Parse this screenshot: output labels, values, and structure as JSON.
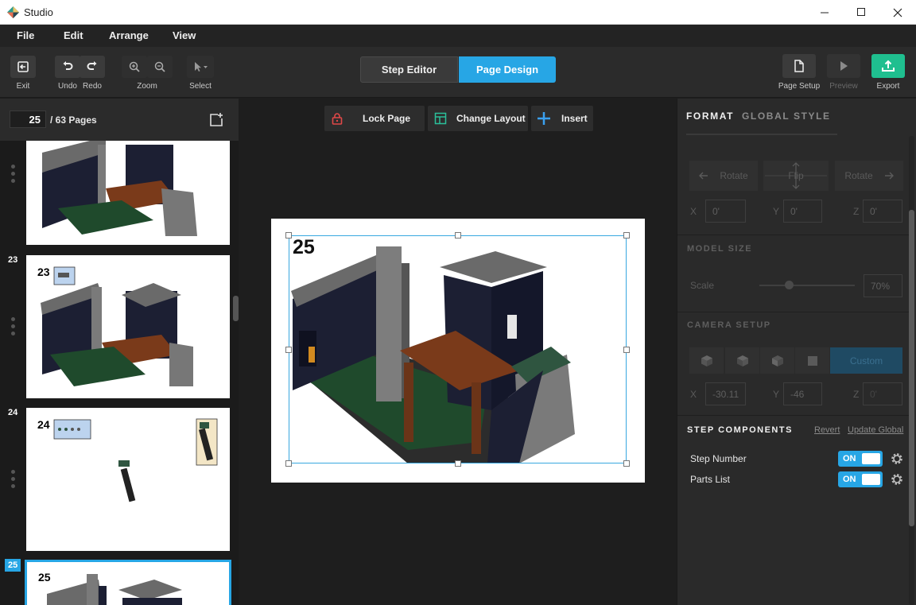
{
  "window": {
    "title": "Studio"
  },
  "menu": [
    "File",
    "Edit",
    "Arrange",
    "View"
  ],
  "toolbar": {
    "exit": "Exit",
    "undo": "Undo",
    "redo": "Redo",
    "zoom": "Zoom",
    "select": "Select",
    "step_editor": "Step Editor",
    "page_design": "Page Design",
    "page_setup": "Page Setup",
    "preview": "Preview",
    "export": "Export"
  },
  "pages": {
    "current": "25",
    "total_label": "/ 63 Pages",
    "thumbnails": [
      {
        "number": "",
        "step": ""
      },
      {
        "number": "23",
        "step": "23"
      },
      {
        "number": "24",
        "step": "24"
      },
      {
        "number": "25",
        "step": "25",
        "selected": true
      }
    ]
  },
  "canvas_actions": {
    "lock": "Lock Page",
    "layout": "Change Layout",
    "insert": "Insert"
  },
  "page": {
    "step_number": "25"
  },
  "format": {
    "tabs": [
      "FORMAT",
      "GLOBAL STYLE"
    ],
    "orientation_buttons": [
      "Rotate",
      "Flip",
      "Rotate"
    ],
    "rotation": {
      "x": "0'",
      "y": "0'",
      "z": "0'"
    },
    "model_size": {
      "heading": "MODEL SIZE",
      "scale_label": "Scale",
      "scale_value": "70%",
      "scale_fraction": 0.31
    },
    "camera": {
      "heading": "CAMERA SETUP",
      "custom": "Custom",
      "x": "-30.11",
      "y": "-46",
      "z": "0'"
    },
    "step_components": {
      "heading": "STEP COMPONENTS",
      "revert": "Revert",
      "update_global": "Update Global",
      "items": [
        {
          "label": "Step Number",
          "state": "ON"
        },
        {
          "label": "Parts List",
          "state": "ON"
        }
      ]
    }
  },
  "axis_labels": {
    "x": "X",
    "y": "Y",
    "z": "Z"
  },
  "colors": {
    "accent": "#27a6e5",
    "export_green": "#1fbf8f",
    "lock_red": "#e04848",
    "layout_teal": "#2bbf9a"
  }
}
